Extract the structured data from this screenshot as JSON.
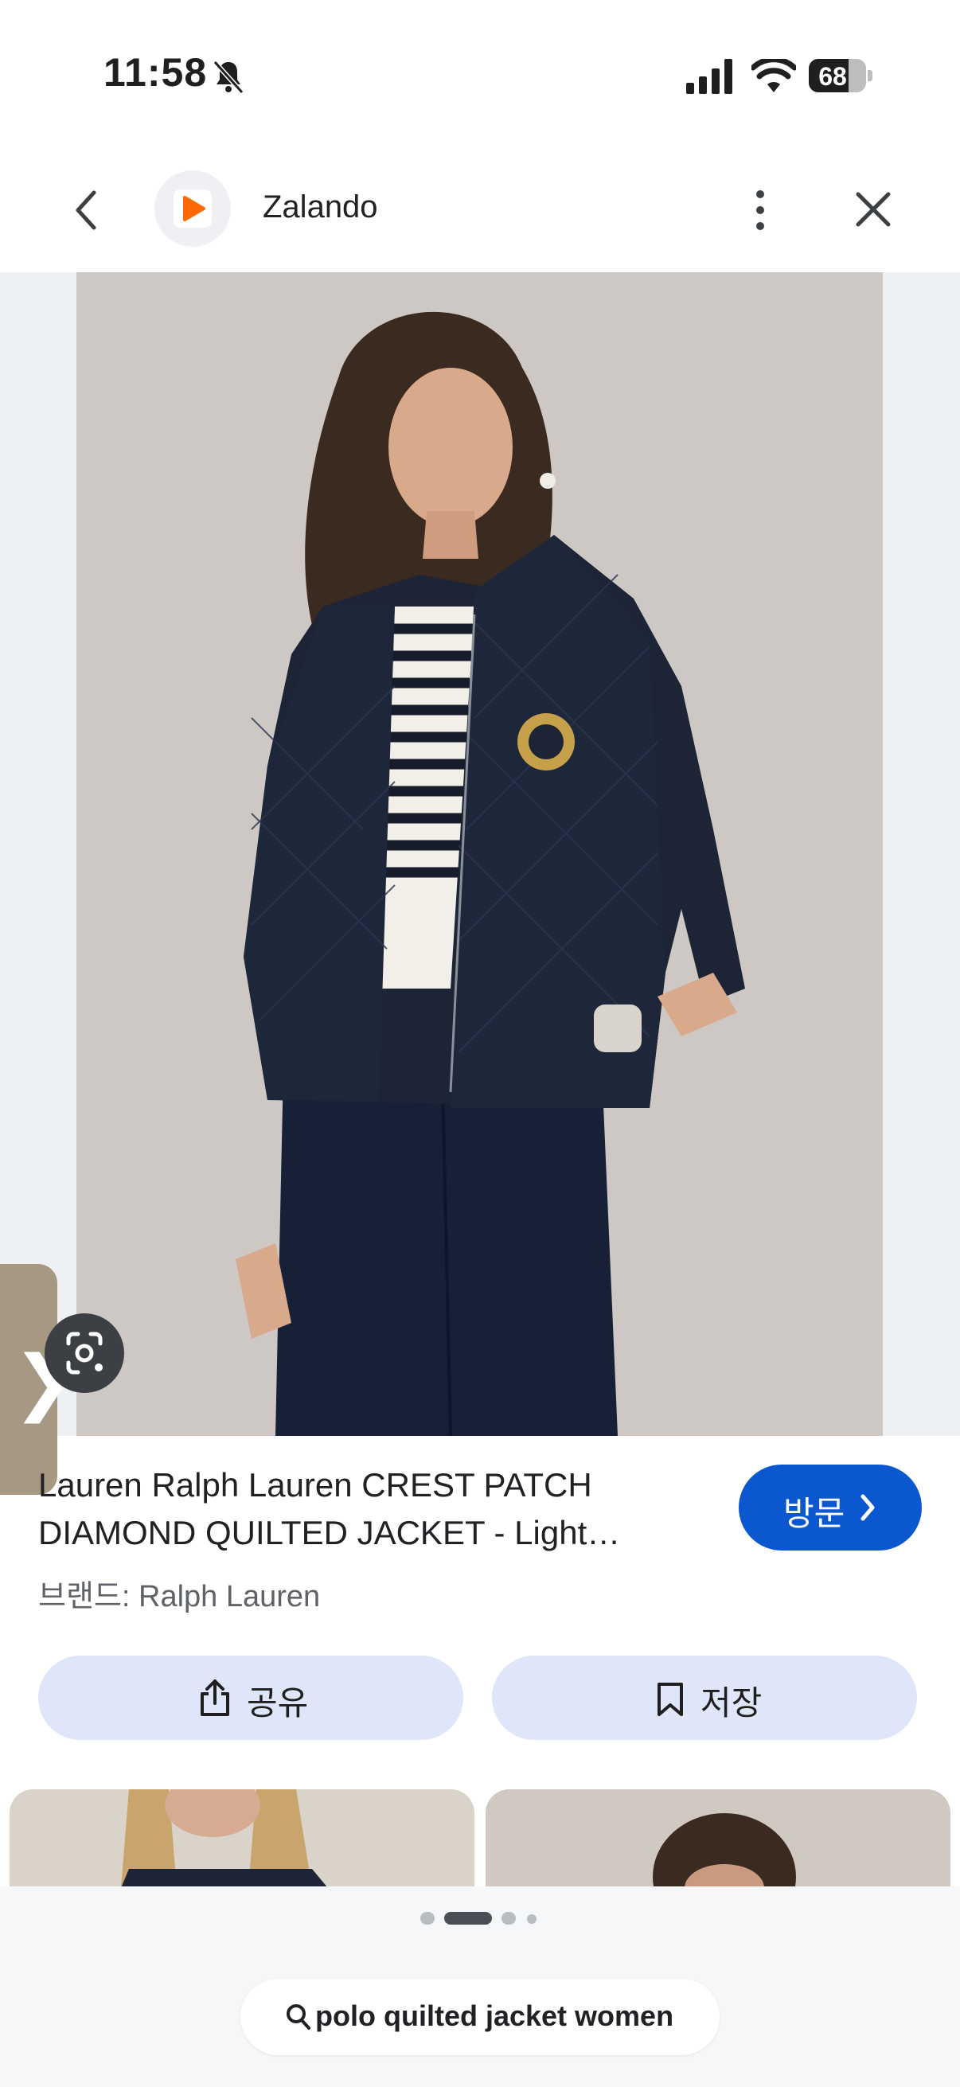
{
  "status_bar": {
    "time": "11:58",
    "battery": "68",
    "icons": [
      "bell-slash-icon",
      "signal-icon",
      "wifi-icon",
      "battery-icon"
    ]
  },
  "header": {
    "site_name": "Zalando",
    "icons": [
      "back-arrow-icon",
      "zalando-logo",
      "more-vert-icon",
      "close-icon"
    ]
  },
  "product": {
    "title_line1": "Lauren Ralph Lauren CREST PATCH",
    "title_line2": "DIAMOND QUILTED JACKET - Light…",
    "brand": "브랜드: Ralph Lauren",
    "visit_label": "방문"
  },
  "actions": {
    "share_label": "공유",
    "save_label": "저장"
  },
  "search": {
    "query": "polo quilted jacket women"
  },
  "pager": {
    "count": 4,
    "active_index": 1
  },
  "colors": {
    "accent": "#0b57d0",
    "pill_bg": "#dfe6f9",
    "handle": "#a79884",
    "jacket_navy": "#1c2436"
  }
}
